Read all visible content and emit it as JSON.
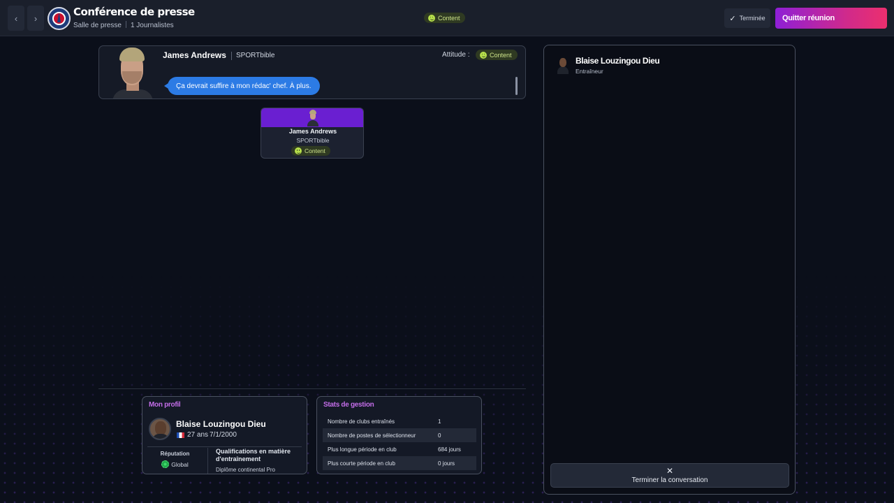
{
  "header": {
    "title": "Conférence de presse",
    "subtitle_location": "Salle de presse",
    "subtitle_count": "1 Journalistes",
    "status": "Content",
    "done_label": "Terminée",
    "quit_label": "Quitter réunion"
  },
  "speech": {
    "name": "James Andrews",
    "outlet": "SPORTbible",
    "attitude_label": "Attitude :",
    "attitude": "Content",
    "message": "Ça devrait suffire à mon rédac' chef. À plus."
  },
  "journalist": {
    "name": "James Andrews",
    "outlet": "SPORTbible",
    "mood": "Content"
  },
  "profile": {
    "title": "Mon profil",
    "name": "Blaise Louzingou Dieu",
    "age": "27 ans",
    "dob": "7/1/2000",
    "reputation_label": "Réputation",
    "reputation_value": "Global",
    "qualifications_label": "Qualifications en matière d'entraînement",
    "qualifications_value": "Diplôme continental Pro"
  },
  "stats": {
    "title": "Stats de gestion",
    "rows": [
      {
        "label": "Nombre de clubs entraînés",
        "value": "1"
      },
      {
        "label": "Nombre de postes de sélectionneur",
        "value": "0"
      },
      {
        "label": "Plus longue période en club",
        "value": "684 jours"
      },
      {
        "label": "Plus courte période en club",
        "value": "0 jours"
      }
    ]
  },
  "conversation": {
    "name": "Blaise Louzingou Dieu",
    "role": "Entraîneur",
    "end_label": "Terminer la conversation"
  },
  "colors": {
    "accent_purple": "#6a1fd1",
    "quit_gradient_start": "#8e1fd6",
    "quit_gradient_end": "#ec2f6e",
    "speech_blue": "#2c7be5",
    "mood_green": "#b7e04b",
    "panel_title": "#c36de8"
  },
  "icons": [
    "chevron-left-icon",
    "chevron-right-icon",
    "club-crest-icon",
    "smiley-icon",
    "check-icon",
    "globe-icon",
    "flag-france-icon",
    "close-icon"
  ]
}
